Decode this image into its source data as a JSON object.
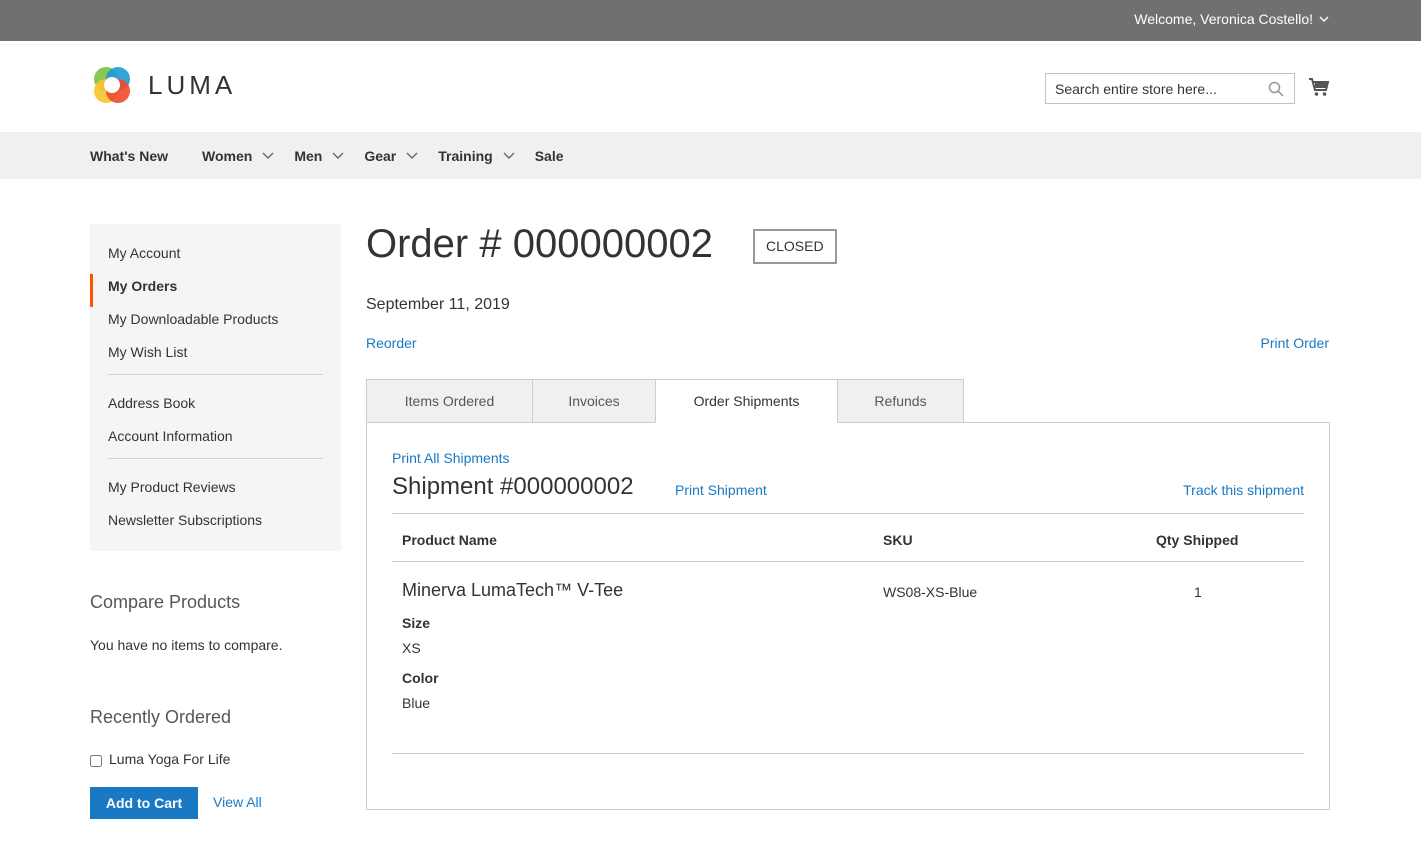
{
  "topbar": {
    "welcome": "Welcome, Veronica Costello!"
  },
  "header": {
    "logo_text": "LUMA",
    "search_placeholder": "Search entire store here...",
    "icons": [
      "search-icon",
      "cart-icon",
      "chevron-down-icon"
    ]
  },
  "nav": {
    "items": [
      {
        "label": "What's New",
        "has_submenu": false
      },
      {
        "label": "Women",
        "has_submenu": true
      },
      {
        "label": "Men",
        "has_submenu": true
      },
      {
        "label": "Gear",
        "has_submenu": true
      },
      {
        "label": "Training",
        "has_submenu": true
      },
      {
        "label": "Sale",
        "has_submenu": false
      }
    ]
  },
  "sidebar": {
    "group1": [
      "My Account",
      "My Orders",
      "My Downloadable Products",
      "My Wish List"
    ],
    "group2": [
      "Address Book",
      "Account Information"
    ],
    "group3": [
      "My Product Reviews",
      "Newsletter Subscriptions"
    ],
    "active": "My Orders"
  },
  "compare": {
    "title": "Compare Products",
    "empty_text": "You have no items to compare."
  },
  "recent": {
    "title": "Recently Ordered",
    "item": "Luma Yoga For Life",
    "add_to_cart": "Add to Cart",
    "view_all": "View All"
  },
  "order": {
    "title": "Order # 000000002",
    "status": "Closed",
    "date": "September 11, 2019",
    "reorder": "Reorder",
    "print_order": "Print Order"
  },
  "tabs": [
    "Items Ordered",
    "Invoices",
    "Order Shipments",
    "Refunds"
  ],
  "active_tab": "Order Shipments",
  "shipment": {
    "print_all": "Print All Shipments",
    "title": "Shipment #000000002",
    "print": "Print Shipment",
    "track": "Track this shipment",
    "columns": [
      "Product Name",
      "SKU",
      "Qty Shipped"
    ],
    "item": {
      "name": "Minerva LumaTech™ V-Tee",
      "options": [
        {
          "label": "Size",
          "value": "XS"
        },
        {
          "label": "Color",
          "value": "Blue"
        }
      ],
      "sku": "WS08-XS-Blue",
      "qty": "1"
    }
  },
  "colors": {
    "accent": "#1979c3",
    "active_marker": "#ff5501",
    "topbar": "#6e716e"
  }
}
